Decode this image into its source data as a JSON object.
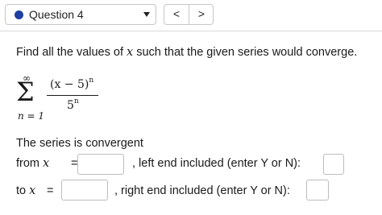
{
  "header": {
    "question_label": "Question 4",
    "prev_icon": "chevron-left-icon",
    "next_icon": "chevron-right-icon",
    "prev_glyph": "<",
    "next_glyph": ">",
    "status_color": "#1d3fa0"
  },
  "problem": {
    "prompt_before": "Find all the values of ",
    "prompt_var": "x",
    "prompt_after": " such that the given series would converge.",
    "sum_upper": "∞",
    "sum_symbol": "Σ",
    "sum_lower": "n = 1",
    "numerator": "(x − 5)",
    "numerator_exp": "n",
    "denominator": "5",
    "denominator_exp": "n"
  },
  "answer": {
    "series_convergent": "The series is convergent",
    "from_label": "from ",
    "var": "x",
    "eq": " = ",
    "from_value": "",
    "left_text": ", left end included (enter Y or N):",
    "left_value": "",
    "to_label": "to ",
    "to_value": "",
    "right_text": ", right end included (enter Y or N):",
    "right_value": ""
  }
}
